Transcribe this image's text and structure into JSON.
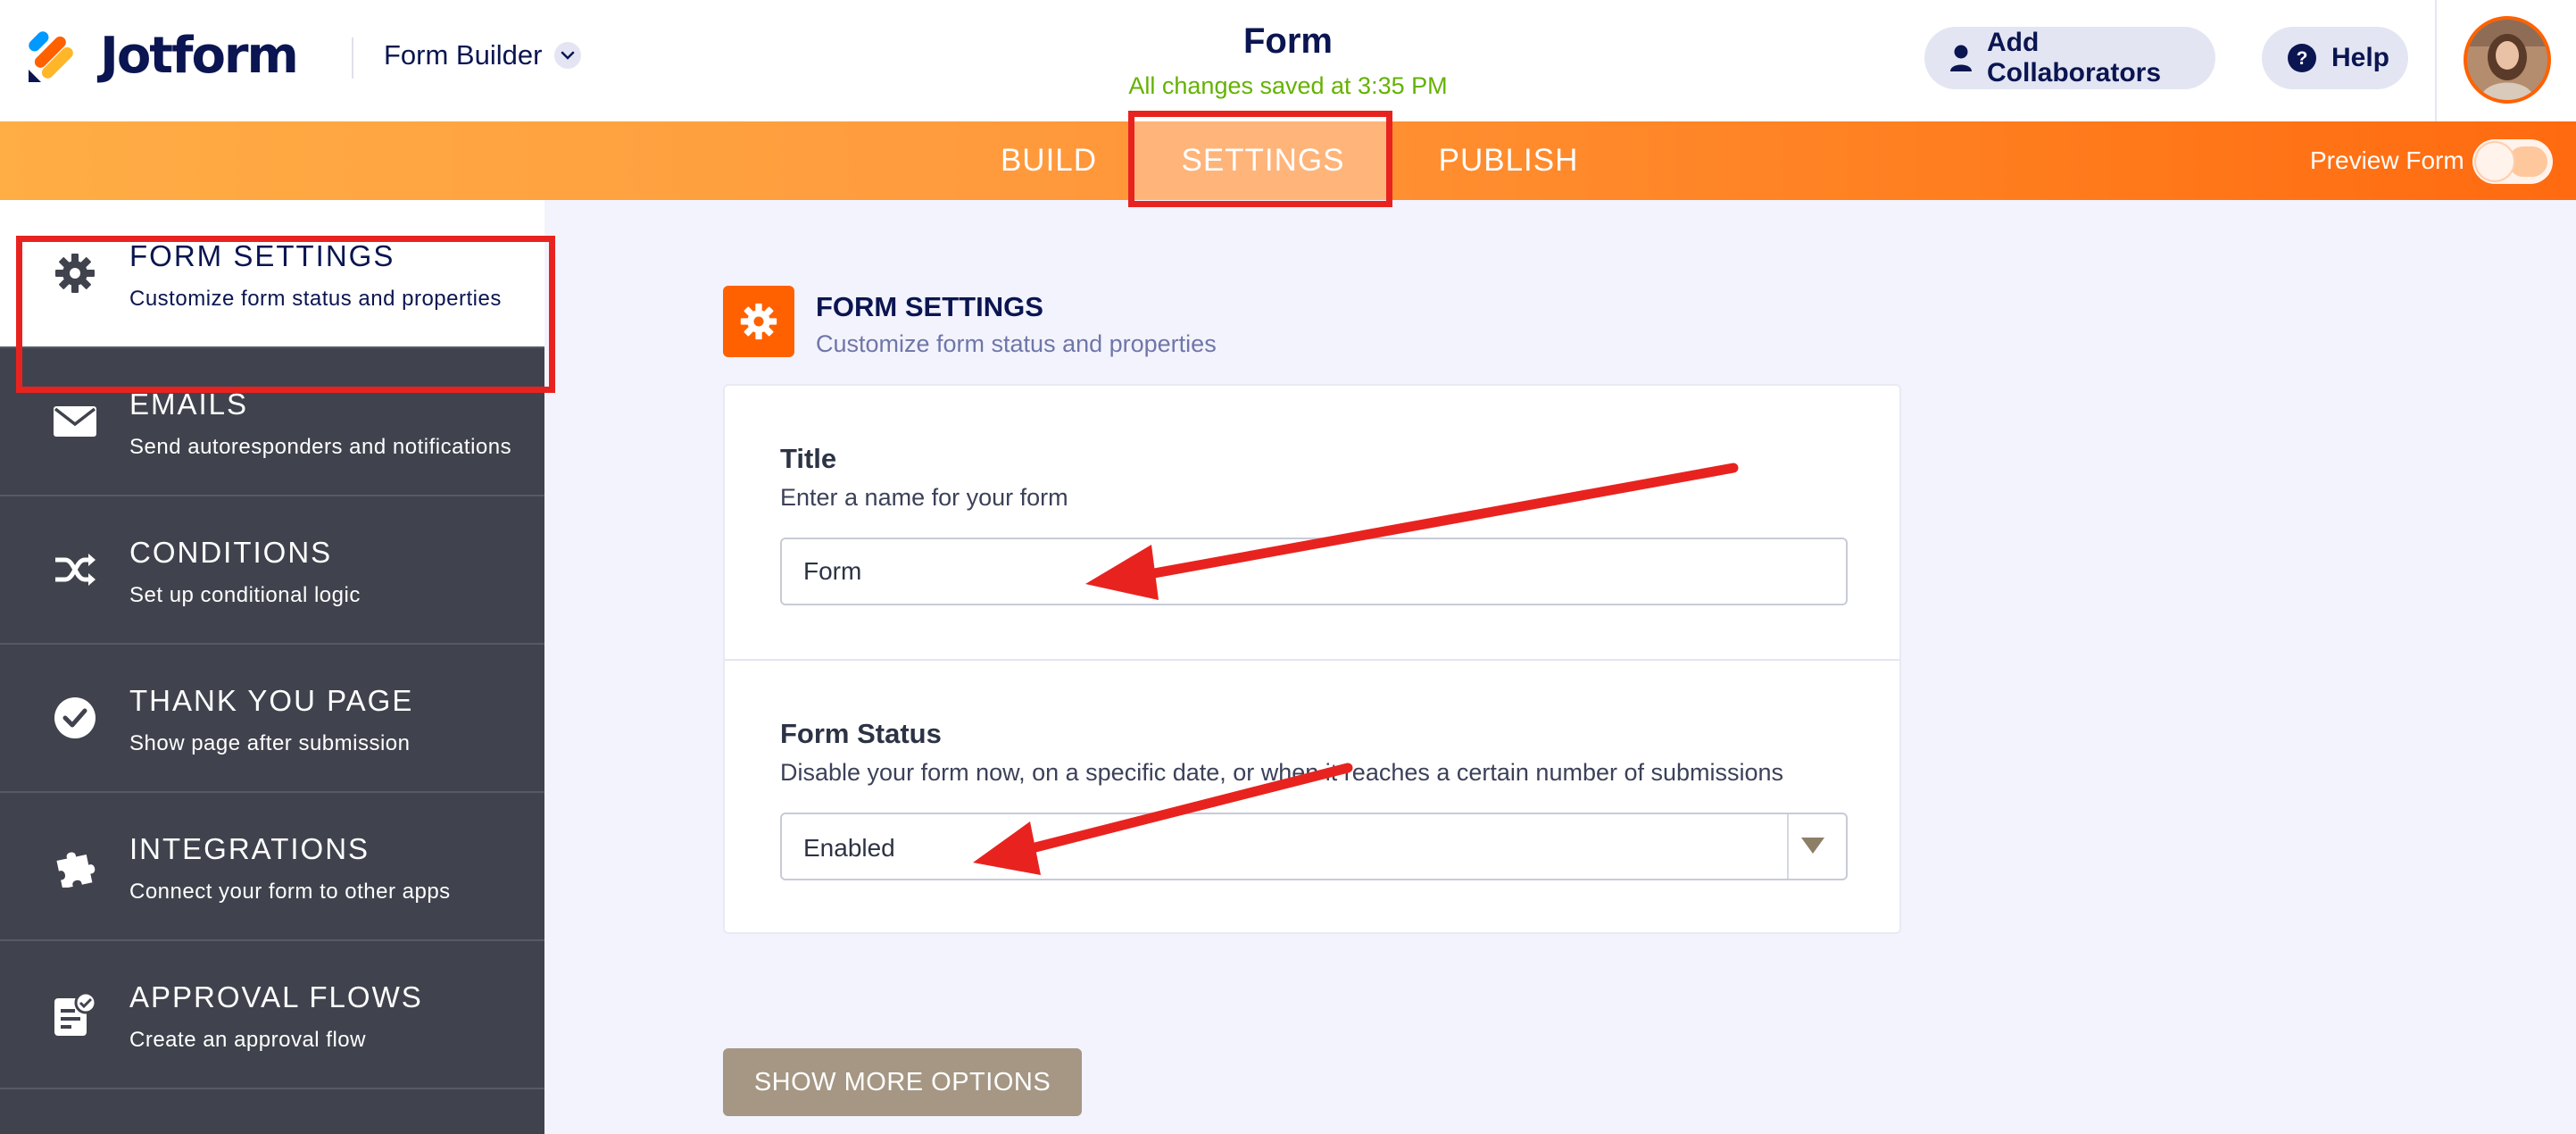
{
  "header": {
    "logo_text": "Jotform",
    "builder_menu_label": "Form Builder",
    "form_title": "Form",
    "save_status": "All changes saved at 3:35 PM",
    "add_collaborators_label": "Add Collaborators",
    "help_label": "Help"
  },
  "nav": {
    "tabs": [
      {
        "label": "BUILD",
        "active": false
      },
      {
        "label": "SETTINGS",
        "active": true
      },
      {
        "label": "PUBLISH",
        "active": false
      }
    ],
    "preview_label": "Preview Form",
    "preview_enabled": false
  },
  "sidebar": {
    "items": [
      {
        "title": "FORM SETTINGS",
        "desc": "Customize form status and properties",
        "icon": "gear-icon",
        "active": true
      },
      {
        "title": "EMAILS",
        "desc": "Send autoresponders and notifications",
        "icon": "envelope-icon",
        "active": false
      },
      {
        "title": "CONDITIONS",
        "desc": "Set up conditional logic",
        "icon": "shuffle-icon",
        "active": false
      },
      {
        "title": "THANK YOU PAGE",
        "desc": "Show page after submission",
        "icon": "check-circle-icon",
        "active": false
      },
      {
        "title": "INTEGRATIONS",
        "desc": "Connect your form to other apps",
        "icon": "puzzle-icon",
        "active": false
      },
      {
        "title": "APPROVAL FLOWS",
        "desc": "Create an approval flow",
        "icon": "approval-icon",
        "active": false
      }
    ]
  },
  "main": {
    "section_title": "FORM SETTINGS",
    "section_desc": "Customize form status and properties",
    "title_field": {
      "label": "Title",
      "desc": "Enter a name for your form",
      "value": "Form"
    },
    "status_field": {
      "label": "Form Status",
      "desc": "Disable your form now, on a specific date, or when it reaches a certain number of submissions",
      "value": "Enabled"
    },
    "more_options_label": "SHOW MORE OPTIONS"
  },
  "colors": {
    "brand_orange": "#ff6100",
    "navy": "#0a1551",
    "sidebar_bg": "#40434d",
    "save_green": "#64b200",
    "annotation_red": "#e8231f",
    "more_button": "#a59784"
  }
}
